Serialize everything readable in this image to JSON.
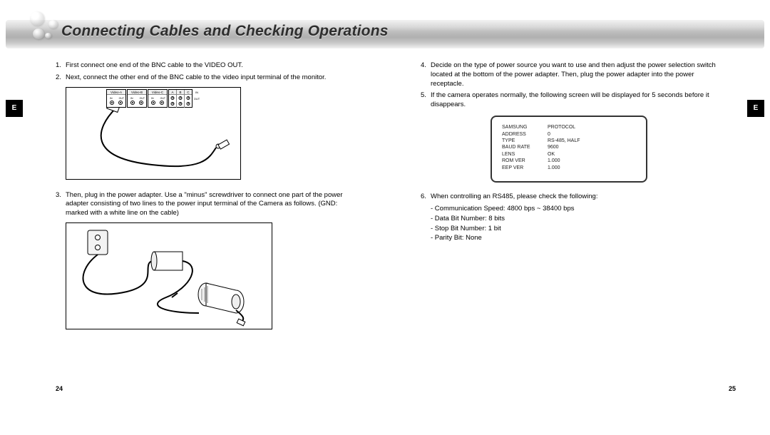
{
  "title": "Connecting Cables and Checking Operations",
  "side_tab": "E",
  "left_page_number": "24",
  "right_page_number": "25",
  "left": {
    "step1": "First connect one end of the BNC cable to the VIDEO OUT.",
    "step2": "Next, connect the other end of the BNC cable to the video input terminal of the monitor.",
    "step3": "Then, plug in the power adapter. Use a \"minus\" screwdriver to connect one part of the power adapter consisting of two lines to the power input terminal of the Camera as follows. (GND: marked with a white line on the cable)",
    "fig1": {
      "labels": [
        "Video-A",
        "Video-B",
        "Video-C"
      ],
      "abc": [
        "A",
        "B",
        "C"
      ],
      "in": "IN",
      "out": "OUT"
    }
  },
  "right": {
    "step4": "Decide on the type of power source you want to use and then adjust the power selection switch located at the bottom of the power adapter. Then, plug the power adapter into the power receptacle.",
    "step5": "If the camera operates normally, the following screen will be displayed for 5 seconds before it disappears.",
    "step6": "When controlling an RS485, please check the following:",
    "step6_items": {
      "a": "- Communication Speed: 4800 bps ~ 38400 bps",
      "b": "- Data Bit Number: 8 bits",
      "c": "- Stop Bit Number: 1 bit",
      "d": "- Parity Bit: None"
    },
    "screen": {
      "r1k": "SAMSUNG",
      "r1v": "PROTOCOL",
      "r2k": "ADDRESS",
      "r2v": "0",
      "r3k": "TYPE",
      "r3v": "RS-485, HALF",
      "r4k": "BAUD RATE",
      "r4v": "9600",
      "r5k": "LENS",
      "r5v": "OK",
      "r6k": "ROM VER",
      "r6v": "1.000",
      "r7k": "EEP VER",
      "r7v": "1.000"
    }
  }
}
